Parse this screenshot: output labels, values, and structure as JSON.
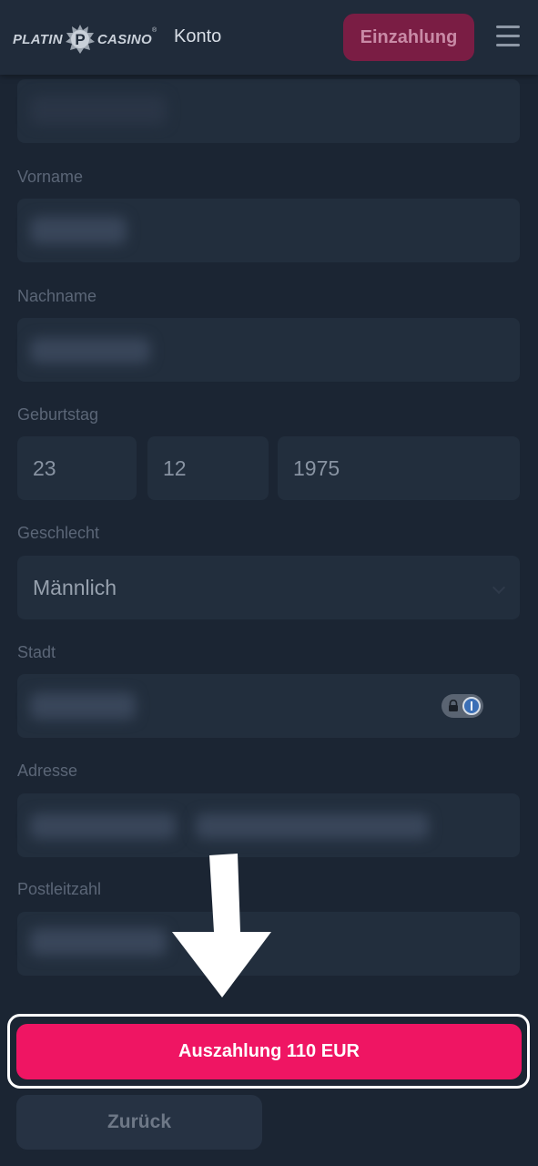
{
  "header": {
    "logo_left": "PLATIN",
    "logo_right": "CASINO",
    "logo_tm": "®",
    "title": "Konto",
    "deposit_label": "Einzahlung"
  },
  "form": {
    "first_name_label": "Vorname",
    "last_name_label": "Nachname",
    "birthday_label": "Geburtstag",
    "birthday": {
      "day": "23",
      "month": "12",
      "year": "1975"
    },
    "gender_label": "Geschlecht",
    "gender_value": "Männlich",
    "city_label": "Stadt",
    "address_label": "Adresse",
    "zip_label": "Postleitzahl"
  },
  "actions": {
    "payout_label": "Auszahlung 110 EUR",
    "back_label": "Zurück"
  },
  "colors": {
    "accent": "#ef1563",
    "background": "#1b2533",
    "field": "#222e3d"
  },
  "icons": [
    "menu-icon",
    "password-manager-icon",
    "down-arrow-annotation"
  ]
}
